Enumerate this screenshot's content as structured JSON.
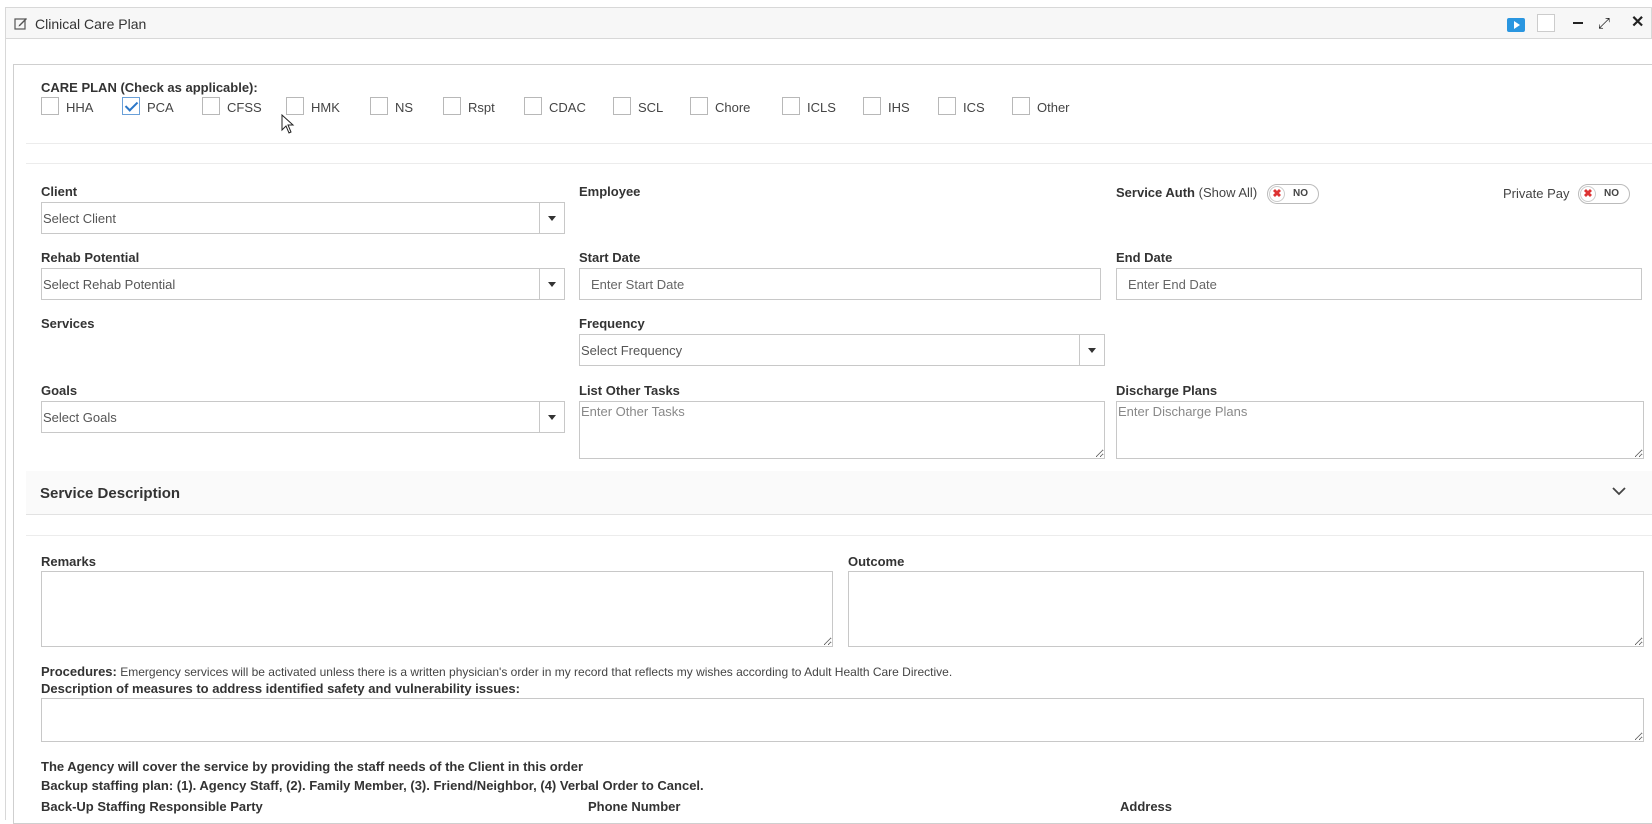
{
  "window": {
    "title": "Clinical Care Plan",
    "icons": [
      "edit-icon",
      "play-icon",
      "square-icon",
      "minimize-icon",
      "expand-icon",
      "close-icon"
    ]
  },
  "care_plan": {
    "title": "CARE PLAN (Check as applicable):",
    "options": [
      {
        "label": "HHA",
        "checked": false
      },
      {
        "label": "PCA",
        "checked": true
      },
      {
        "label": "CFSS",
        "checked": false
      },
      {
        "label": "HMK",
        "checked": false
      },
      {
        "label": "NS",
        "checked": false
      },
      {
        "label": "Rspt",
        "checked": false
      },
      {
        "label": "CDAC",
        "checked": false
      },
      {
        "label": "SCL",
        "checked": false
      },
      {
        "label": "Chore",
        "checked": false
      },
      {
        "label": "ICLS",
        "checked": false
      },
      {
        "label": "IHS",
        "checked": false
      },
      {
        "label": "ICS",
        "checked": false
      },
      {
        "label": "Other",
        "checked": false
      }
    ]
  },
  "form": {
    "client": {
      "label": "Client",
      "placeholder": "Select Client"
    },
    "employee": {
      "label": "Employee"
    },
    "service_auth": {
      "label": "Service Auth",
      "link": "(Show All)",
      "toggle": "NO"
    },
    "private_pay": {
      "label": "Private Pay",
      "toggle": "NO"
    },
    "rehab": {
      "label": "Rehab Potential",
      "placeholder": "Select Rehab Potential"
    },
    "start_date": {
      "label": "Start Date",
      "placeholder": "Enter Start Date"
    },
    "end_date": {
      "label": "End Date",
      "placeholder": "Enter End Date"
    },
    "services": {
      "label": "Services"
    },
    "frequency": {
      "label": "Frequency",
      "placeholder": "Select Frequency"
    },
    "goals": {
      "label": "Goals",
      "placeholder": "Select Goals"
    },
    "other_tasks": {
      "label": "List Other Tasks",
      "placeholder": "Enter Other Tasks"
    },
    "discharge": {
      "label": "Discharge Plans",
      "placeholder": "Enter Discharge Plans"
    }
  },
  "service_description": {
    "title": "Service Description"
  },
  "remarks": {
    "label": "Remarks"
  },
  "outcome": {
    "label": "Outcome"
  },
  "procedures": {
    "label": "Procedures:",
    "text": "Emergency services will be activated unless there is a written physician's order in my record that reflects my wishes according to Adult Health Care Directive."
  },
  "measures": {
    "label": "Description of measures to address identified safety and vulnerability issues:"
  },
  "agency_text": "The Agency will cover the service by providing the staff needs of the Client in this order",
  "backup_plan_text": "Backup staffing plan: (1). Agency Staff, (2). Family Member, (3). Friend/Neighbor, (4) Verbal Order to Cancel.",
  "backup": {
    "responsible_party": "Back-Up Staffing Responsible Party",
    "phone": "Phone Number",
    "address": "Address"
  }
}
